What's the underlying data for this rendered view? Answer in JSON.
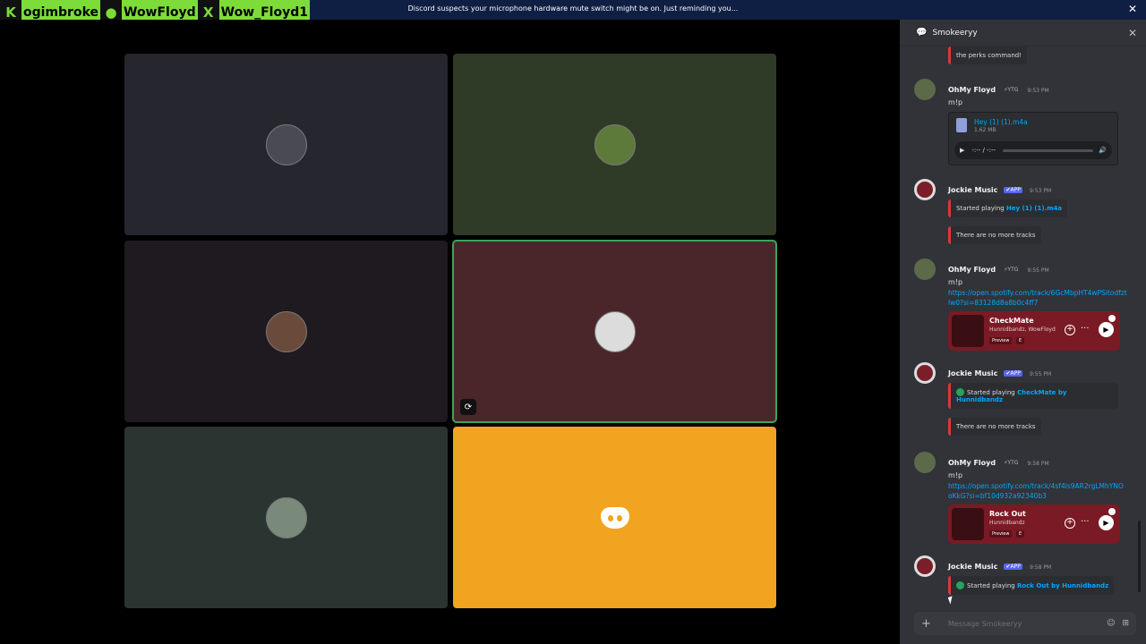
{
  "banner": {
    "text": "Discord suspects your microphone hardware mute switch might be on. Just reminding you...",
    "close": "✕"
  },
  "socials": [
    {
      "icon": "K",
      "name": "ogimbroke",
      "icon_name": "kick-icon"
    },
    {
      "icon": "●",
      "name": "WowFloyd",
      "icon_name": "spotify-icon"
    },
    {
      "icon": "X",
      "name": "Wow_Floyd1",
      "icon_name": "x-icon"
    }
  ],
  "tiles": [
    {
      "color": "#26262e",
      "avatar": "#4a4a55"
    },
    {
      "color": "#2f3b26",
      "avatar": "#5e7a3a"
    },
    {
      "color": "#1e1a1f",
      "avatar": "#6a4a3a"
    },
    {
      "color": "#4a2529",
      "avatar": "#dcdcdc",
      "active": true,
      "share_icon": "⟳"
    },
    {
      "color": "#2a3531",
      "avatar": "#7a8a7a"
    },
    {
      "color": "#f0a41f",
      "discord": true
    }
  ],
  "panel": {
    "title": "Smokeeryy",
    "close": "✕",
    "top_fragment": "the perks command!",
    "messages": [
      {
        "user": "OhMy Floyd",
        "tag": "⚡YTG",
        "time": "9:53 PM",
        "text": "m!p"
      },
      {
        "attachment": {
          "name": "Hey (1) (1).m4a",
          "size": "1.62 MB",
          "time_display": "-:-- / -:--"
        }
      },
      {
        "user": "Jockie Music",
        "tag": "✔APP",
        "time": "9:53 PM",
        "embed_prefix": "Started playing ",
        "embed_link": "Hey (1) (1).m4a"
      },
      {
        "embed_plain": "There are no more tracks"
      },
      {
        "user": "OhMy Floyd",
        "tag": "⚡YTG",
        "time": "9:55 PM",
        "text": "m!p",
        "link": "https://open.spotify.com/track/6GcMbpHT4wPSitodfztlw0?si=83128d8a8b0c4ff7",
        "card": {
          "title": "CheckMate",
          "sub": "Hunnidbandz, WowFloyd",
          "preview": "Preview",
          "e": "E"
        }
      },
      {
        "user": "Jockie Music",
        "tag": "✔APP",
        "time": "9:55 PM",
        "embed_prefix": "Started playing ",
        "embed_link": "CheckMate by Hunnidbandz"
      },
      {
        "embed_plain": "There are no more tracks"
      },
      {
        "user": "OhMy Floyd",
        "tag": "⚡YTG",
        "time": "9:58 PM",
        "text": "m!p",
        "link": "https://open.spotify.com/track/4sf4ls9AR2rgLMhYNOoKkG?si=bf10d932a92340b3",
        "card": {
          "title": "Rock Out",
          "sub": "Hunnidbandz",
          "preview": "Preview",
          "e": "E"
        }
      },
      {
        "user": "Jockie Music",
        "tag": "✔APP",
        "time": "9:58 PM",
        "embed_prefix": "Started playing ",
        "embed_link": "Rock Out by Hunnidbandz"
      }
    ],
    "composer_placeholder": "Message Smokeeryy"
  },
  "colors": {
    "accent_green": "#7ddc3a",
    "discord_blue": "#5865f2",
    "spotify_green": "#23a55a",
    "link_blue": "#00a8fc"
  }
}
